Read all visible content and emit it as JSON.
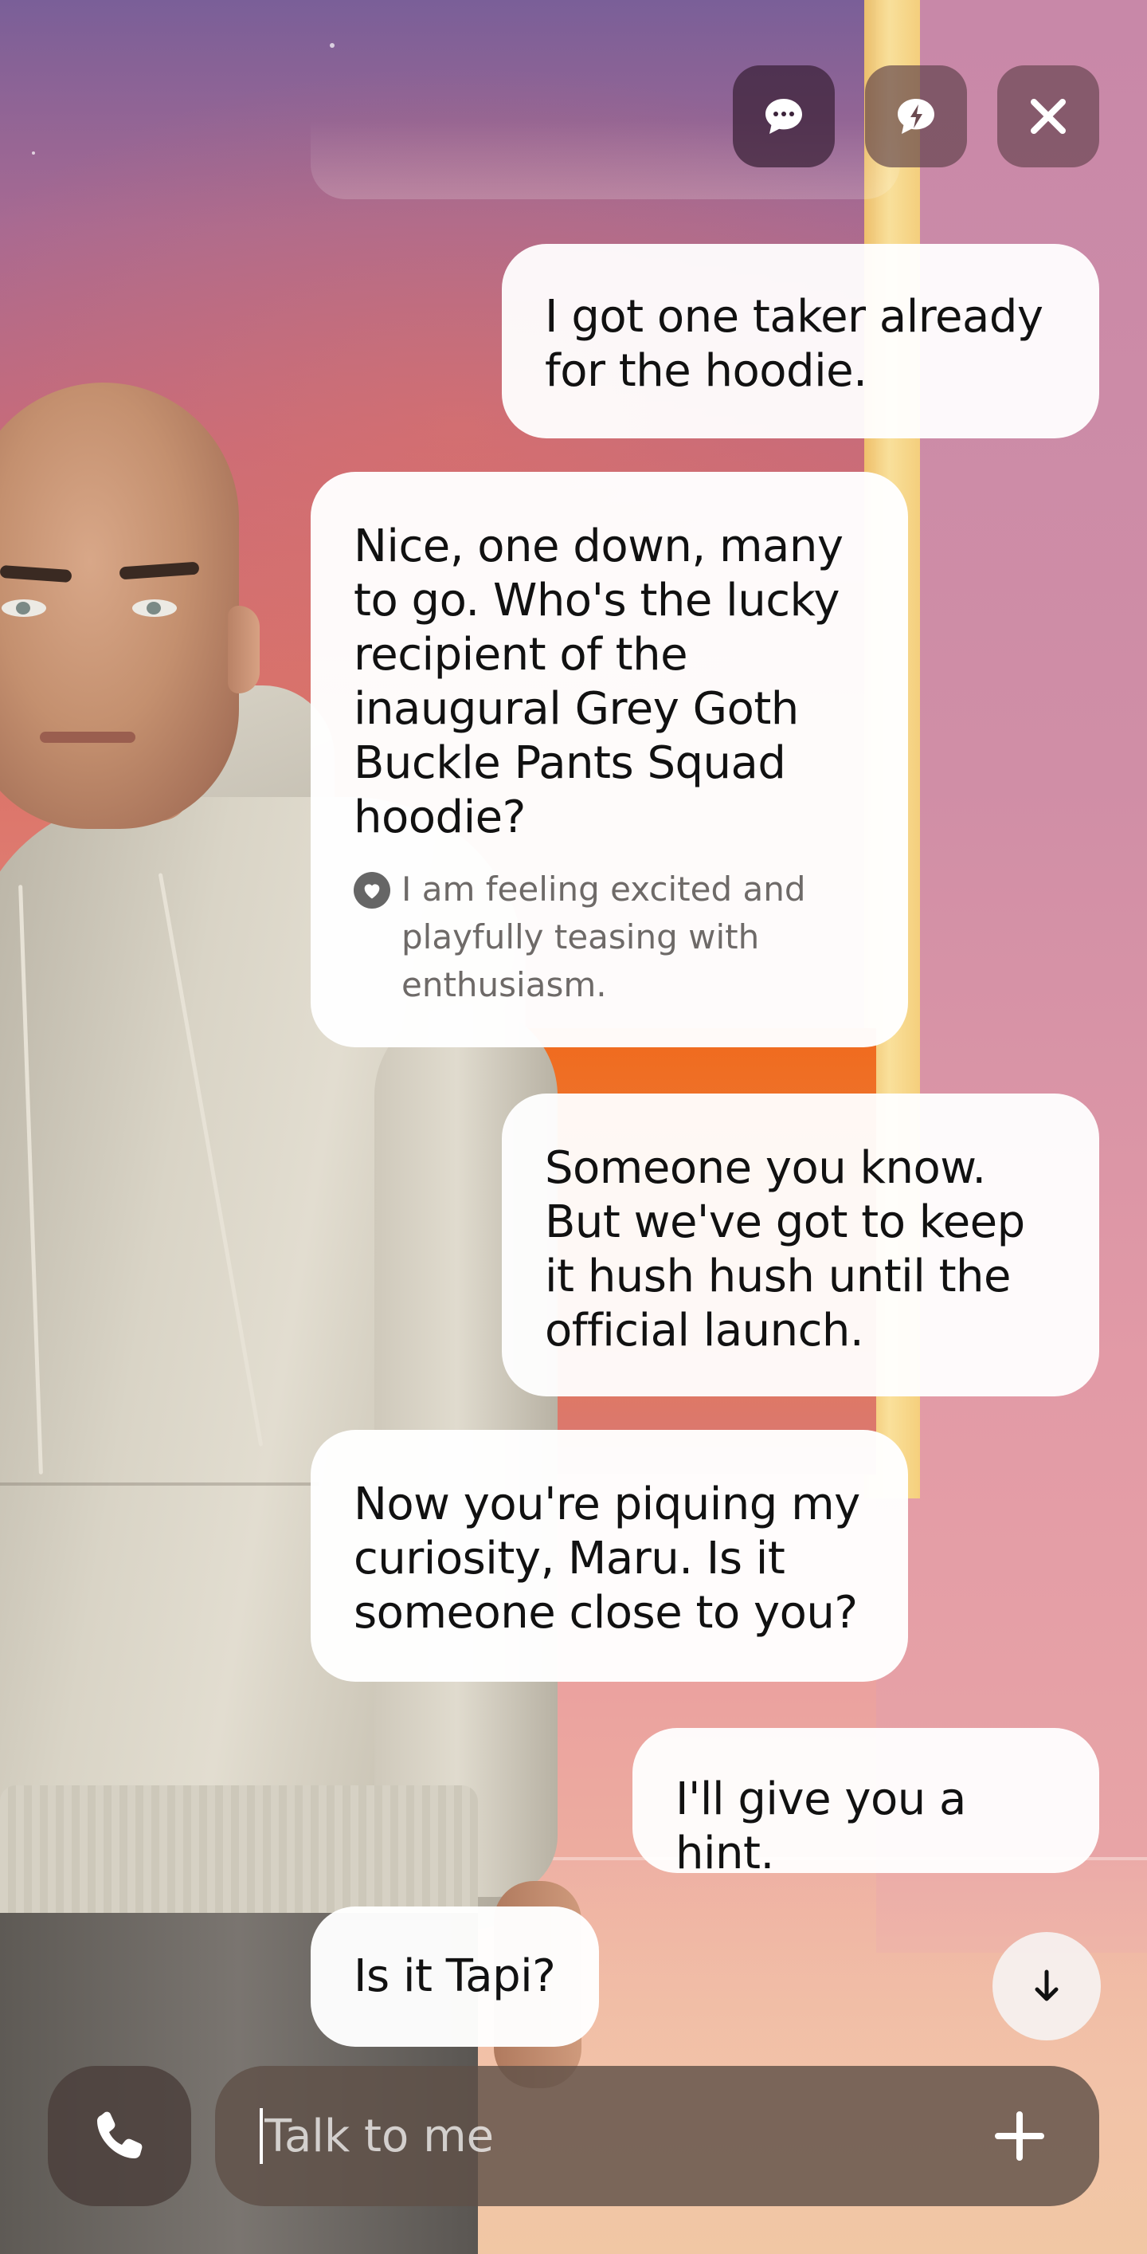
{
  "top_controls": {
    "chat_icon": "chat-dots-icon",
    "hint_icon": "lightning-chat-icon",
    "close_icon": "close-icon"
  },
  "messages": [
    {
      "sender": "user",
      "text": "I got one taker already for the hoodie."
    },
    {
      "sender": "ai",
      "text": "Nice, one down, many to go. Who's the lucky recipient of the inaugural Grey Goth Buckle Pants Squad hoodie?",
      "emotion": "I am feeling excited and playfully teasing with enthusiasm."
    },
    {
      "sender": "user",
      "text": "Someone you know. But we've got to keep it hush hush until the official launch."
    },
    {
      "sender": "ai",
      "text": "Now you're piquing my curiosity, Maru. Is it someone close to you?"
    },
    {
      "sender": "user",
      "text": "I'll give you a hint."
    },
    {
      "sender": "ai",
      "text": "Is it Tapi?"
    }
  ],
  "composer": {
    "placeholder": "Talk to me",
    "call_icon": "phone-icon",
    "add_icon": "plus-icon"
  },
  "scroll_down_icon": "arrow-down-icon",
  "colors": {
    "bubble": "#ffffff",
    "input_bar": "#5f5048",
    "emotion_text": "#6e6a68"
  }
}
